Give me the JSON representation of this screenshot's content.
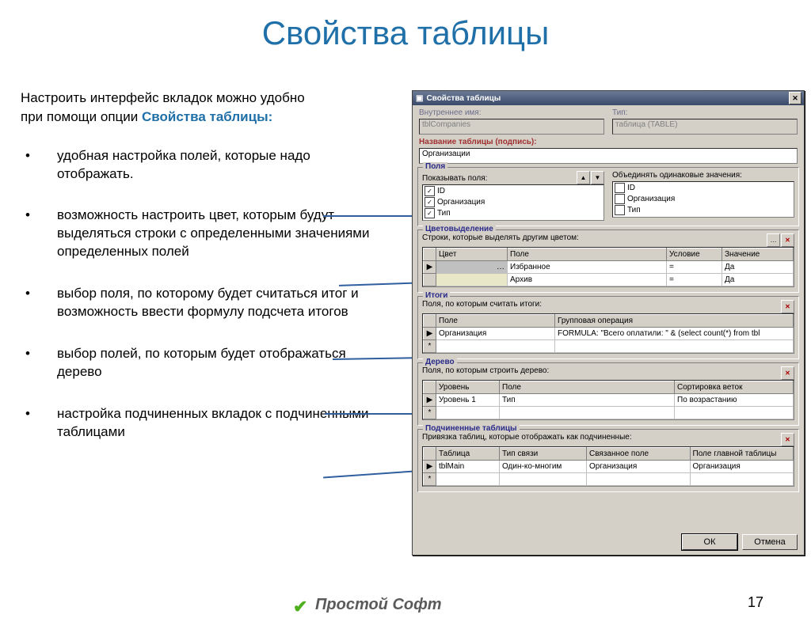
{
  "title": "Свойства таблицы",
  "intro": {
    "line1": "Настроить интерфейс вкладок можно удобно",
    "line2_a": "при помощи опции ",
    "line2_b": "Свойства таблицы:"
  },
  "bullets": [
    "удобная настройка полей, которые надо отображать.",
    "возможность настроить цвет, которым будут выделяться строки с определенными значениями определенных полей",
    "выбор поля, по которому будет считаться итог и возможность ввести формулу подсчета итогов",
    "выбор полей, по которым будет отображаться дерево",
    "настройка подчиненных вкладок с подчиненными таблицами"
  ],
  "page_number": "17",
  "footer_brand": "Простой Софт",
  "dialog": {
    "title": "Свойства таблицы",
    "internal_name_label": "Внутреннее имя:",
    "internal_name_value": "tblCompanies",
    "type_label": "Тип:",
    "type_value": "таблица (TABLE)",
    "caption_label": "Название таблицы (подпись):",
    "caption_value": "Организации",
    "fields": {
      "legend": "Поля",
      "show_label": "Показывать поля:",
      "merge_label": "Объединять одинаковые значения:",
      "show_items": [
        "ID",
        "Организация",
        "Тип"
      ],
      "merge_items": [
        "ID",
        "Организация",
        "Тип"
      ]
    },
    "colors": {
      "legend": "Цветовыделение",
      "hint": "Строки, которые выделять другим цветом:",
      "cols": [
        "Цвет",
        "Поле",
        "Условие",
        "Значение"
      ],
      "rows": [
        [
          "",
          "Избранное",
          "=",
          "Да"
        ],
        [
          "",
          "Архив",
          "=",
          "Да"
        ]
      ]
    },
    "totals": {
      "legend": "Итоги",
      "hint": "Поля, по которым считать итоги:",
      "cols": [
        "Поле",
        "Групповая операция"
      ],
      "rows": [
        [
          "Организация",
          "FORMULA: \"Всего оплатили: \" & (select count(*) from tbl"
        ]
      ]
    },
    "tree": {
      "legend": "Дерево",
      "hint": "Поля, по которым строить дерево:",
      "cols": [
        "Уровень",
        "Поле",
        "Сортировка веток"
      ],
      "rows": [
        [
          "Уровень 1",
          "Тип",
          "По возрастанию"
        ]
      ]
    },
    "subs": {
      "legend": "Подчиненные таблицы",
      "hint": "Привязка таблиц, которые отображать как подчиненные:",
      "cols": [
        "Таблица",
        "Тип связи",
        "Связанное поле",
        "Поле главной таблицы"
      ],
      "rows": [
        [
          "tblMain",
          "Один-ко-многим",
          "Организация",
          "Организация"
        ]
      ]
    },
    "ok": "ОК",
    "cancel": "Отмена"
  }
}
